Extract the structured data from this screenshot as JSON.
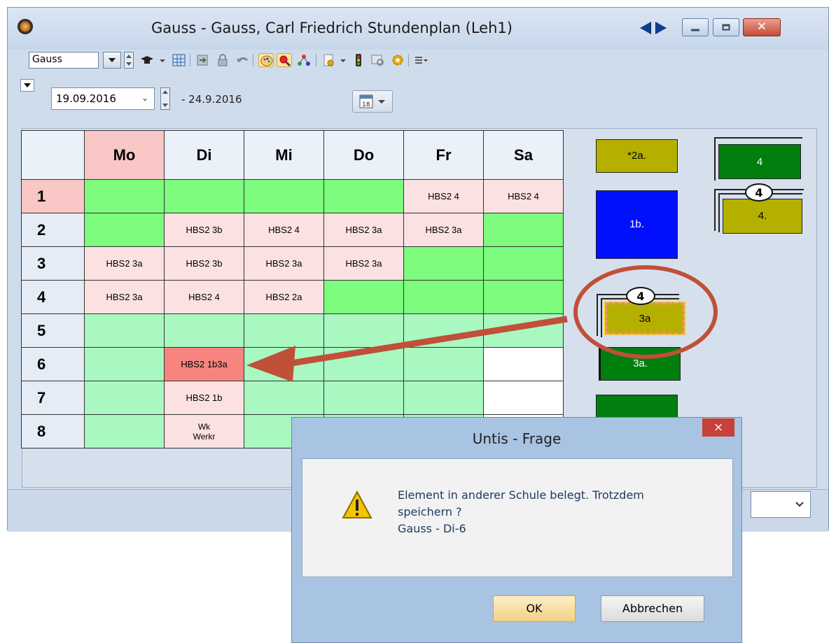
{
  "window": {
    "title": "Gauss - Gauss, Carl Friedrich  Stundenplan  (Leh1)"
  },
  "toolbar": {
    "element_combo_value": "Gauss"
  },
  "subbar": {
    "date_value": "19.09.2016",
    "date_end": "- 24.9.2016"
  },
  "timetable": {
    "days": [
      "Mo",
      "Di",
      "Mi",
      "Do",
      "Fr",
      "Sa"
    ],
    "periods": [
      {
        "num": "1",
        "cells": [
          "",
          "",
          "",
          "",
          "HBS2 4",
          "HBS2 4"
        ]
      },
      {
        "num": "2",
        "cells": [
          "",
          "HBS2 3b",
          "HBS2 4",
          "HBS2 3a",
          "HBS2 3a",
          ""
        ]
      },
      {
        "num": "3",
        "cells": [
          "HBS2 3a",
          "HBS2 3b",
          "HBS2 3a",
          "HBS2 3a",
          "",
          ""
        ]
      },
      {
        "num": "4",
        "cells": [
          "HBS2 3a",
          "HBS2 4",
          "HBS2 2a",
          "",
          "",
          ""
        ]
      },
      {
        "num": "5",
        "cells": [
          "",
          "",
          "",
          "",
          "",
          ""
        ]
      },
      {
        "num": "6",
        "cells": [
          "",
          "HBS2 1b3a",
          "",
          "",
          "",
          ""
        ]
      },
      {
        "num": "7",
        "cells": [
          "",
          "HBS2 1b",
          "",
          "",
          "",
          ""
        ]
      },
      {
        "num": "8",
        "cells": [
          "",
          "Wk\nWerkr",
          "",
          "",
          "",
          ""
        ]
      }
    ]
  },
  "side_cards": {
    "c1": "*2a.",
    "c2": "4",
    "c3": "1b.",
    "c4_badge": "4",
    "c4_label": "4.",
    "c5_badge": "4",
    "c5_label": "3a",
    "c6": "3a."
  },
  "dialog": {
    "title": "Untis - Frage",
    "close_glyph": "×",
    "line1": "Element in anderer Schule belegt. Trotzdem",
    "line2": "speichern ?",
    "line3": "Gauss - Di-6",
    "ok_label": "OK",
    "cancel_label": "Abbrechen"
  },
  "colors": {
    "green": "#7dfc7d",
    "light_green": "#a9f7c1",
    "pink": "#fbe1e1",
    "highlight_red": "#f88480",
    "arrow": "#c0503a"
  }
}
